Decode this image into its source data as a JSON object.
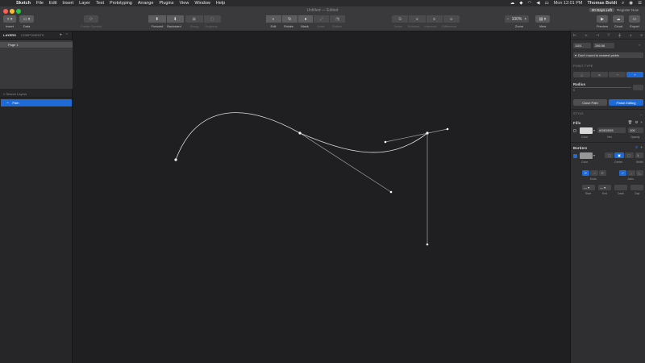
{
  "menubar": {
    "app": "Sketch",
    "items": [
      "File",
      "Edit",
      "Insert",
      "Layer",
      "Text",
      "Prototyping",
      "Arrange",
      "Plugins",
      "View",
      "Window",
      "Help"
    ],
    "clock": "Mon 12:01 PM",
    "user": "Thomas Boldt"
  },
  "window": {
    "title": "Untitled — Edited",
    "trial_badge": "30 Days Left",
    "register": "Register Now"
  },
  "toolbar": {
    "insert": "Insert",
    "data": "Data",
    "create_symbol": "Create Symbol",
    "forward": "Forward",
    "backward": "Backward",
    "group": "Group",
    "ungroup": "Ungroup",
    "edit": "Edit",
    "rotate": "Rotate",
    "mask": "Mask",
    "scale": "Scale",
    "flatten": "Flatten",
    "union": "Union",
    "subtract": "Subtract",
    "intersect": "Intersect",
    "difference": "Difference",
    "zoom_value": "100%",
    "zoom": "Zoom",
    "view": "View",
    "preview": "Preview",
    "cloud": "Cloud",
    "export": "Export"
  },
  "left_panel": {
    "tab_layers": "LAYERS",
    "tab_components": "COMPONENTS",
    "page": "Page 1",
    "search_placeholder": "Search Layers",
    "layer": "Path"
  },
  "inspector": {
    "x": "1101",
    "y": "286.56",
    "rounding": "Don't round to nearest pixels",
    "point_type": "POINT TYPE",
    "radius_label": "Radius",
    "radius_value": "0",
    "close_path": "Close Path",
    "finish_editing": "Finish Editing",
    "style": "STYLE",
    "fills": "Fills",
    "fill_hex": "D8D8D8",
    "fill_opacity": "100",
    "fill_color_label": "Color",
    "fill_hex_label": "Hex",
    "fill_opacity_label": "Opacity",
    "borders": "Borders",
    "border_width": "1",
    "border_color_label": "Color",
    "border_position_label": "Center",
    "border_width_label": "Width",
    "ends_label": "Ends",
    "joins_label": "Joins",
    "start_label": "Start",
    "end_label": "End",
    "dash_label": "Dash",
    "gap_label": "Gap",
    "colors": {
      "accent": "#1e6ad6",
      "fill": "#d8d8d8",
      "border": "#979797"
    }
  }
}
